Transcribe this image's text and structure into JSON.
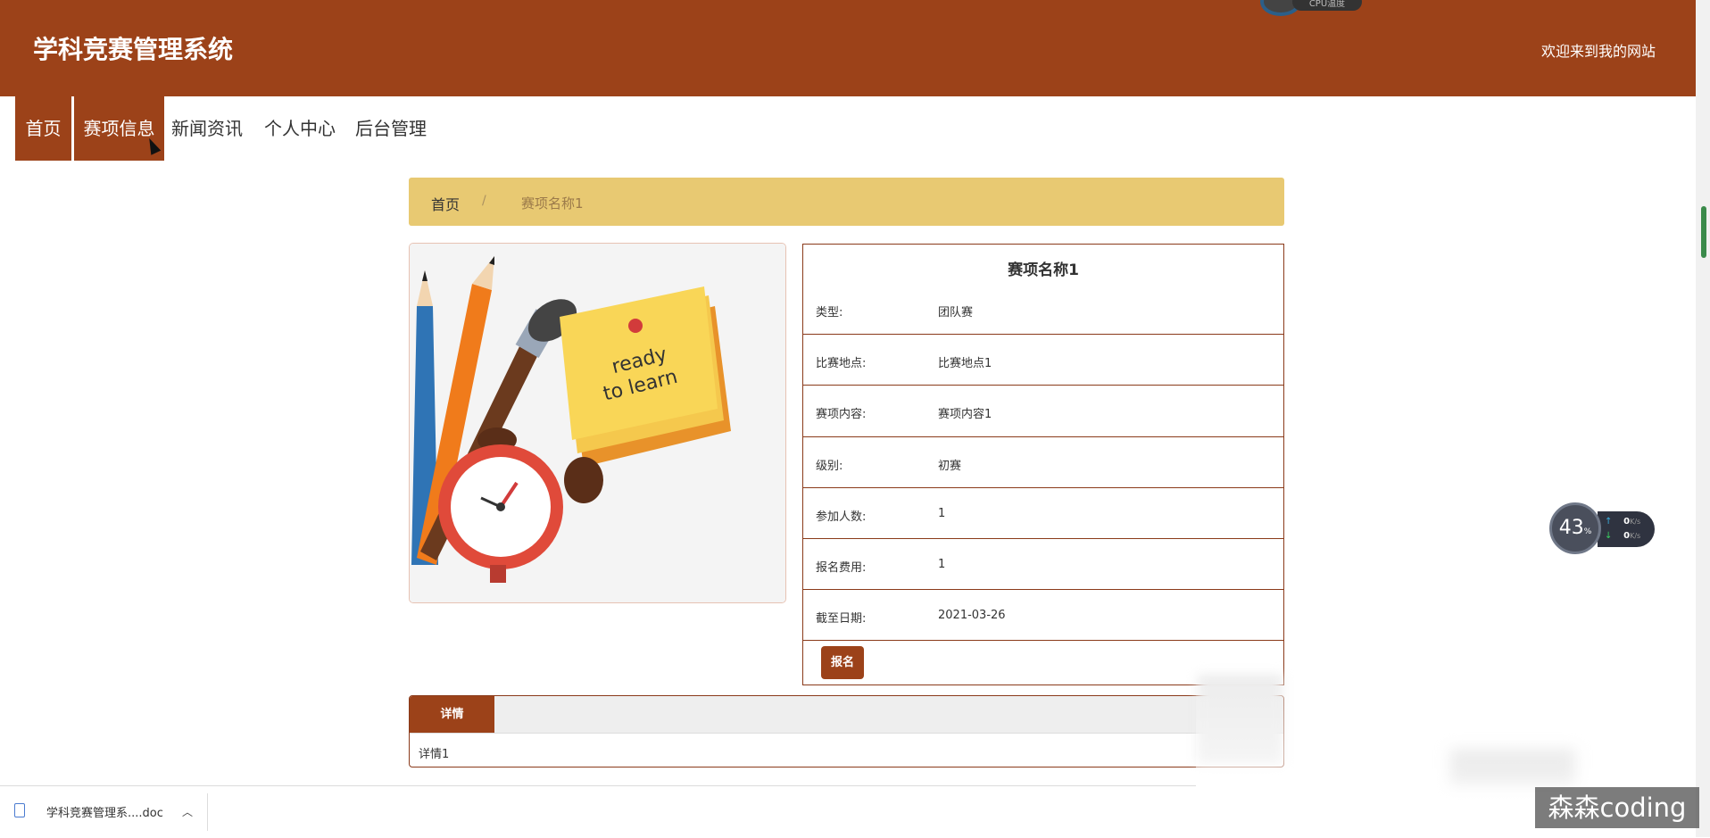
{
  "header": {
    "title": "学科竞赛管理系统",
    "welcome": "欢迎来到我的网站",
    "cpu_widget_label": "CPU温度"
  },
  "nav": {
    "items": [
      "首页",
      "赛项信息",
      "新闻资讯",
      "个人中心",
      "后台管理"
    ],
    "active_items": [
      0,
      1
    ]
  },
  "breadcrumb": {
    "home": "首页",
    "separator": "/",
    "current": "赛项名称1"
  },
  "event": {
    "image_text_line1": "ready",
    "image_text_line2": "to learn",
    "name": "赛项名称1",
    "fields": [
      {
        "label": "类型:",
        "value": "团队赛"
      },
      {
        "label": "比赛地点:",
        "value": "比赛地点1"
      },
      {
        "label": "赛项内容:",
        "value": "赛项内容1"
      },
      {
        "label": "级别:",
        "value": "初赛"
      },
      {
        "label": "参加人数:",
        "value": "1"
      },
      {
        "label": "报名费用:",
        "value": "1"
      },
      {
        "label": "截至日期:",
        "value": "2021-03-26"
      }
    ],
    "signup_button": "报名"
  },
  "details": {
    "tab_label": "详情",
    "content": "详情1"
  },
  "speed_widget": {
    "percent": "43",
    "percent_unit": "%",
    "up": "0",
    "down": "0",
    "unit": "K/s"
  },
  "download_bar": {
    "filename": "学科竞赛管理系....doc"
  },
  "watermark": "森森coding",
  "colors": {
    "brand": "#9c4219",
    "breadcrumb_bg": "#e8c972"
  }
}
